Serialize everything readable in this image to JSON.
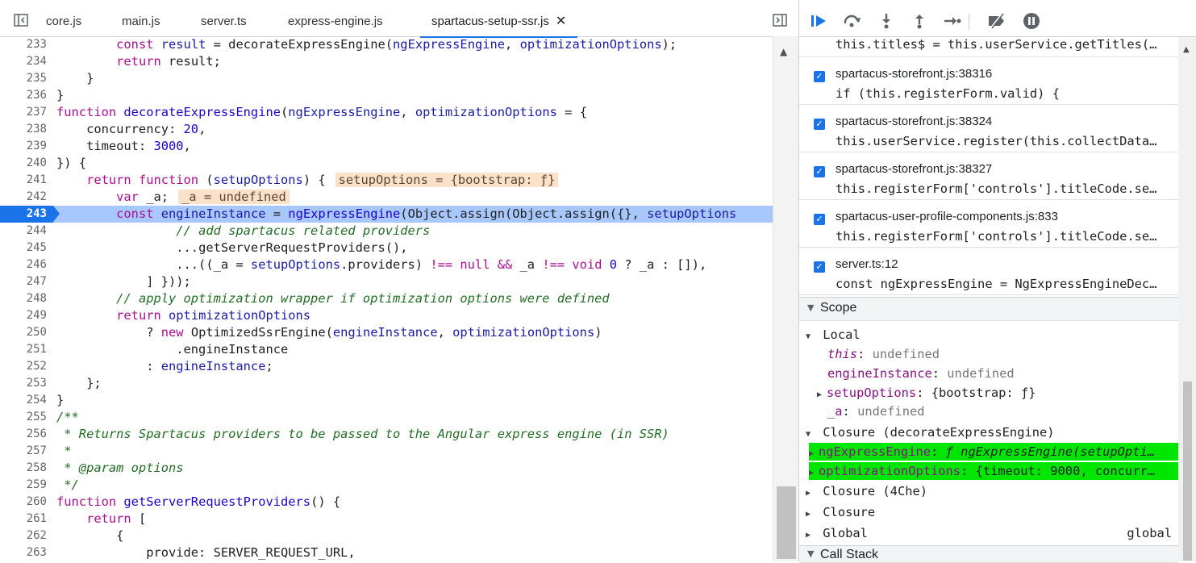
{
  "tabs": [
    {
      "label": "core.js",
      "active": false
    },
    {
      "label": "main.js",
      "active": false
    },
    {
      "label": "server.ts",
      "active": false
    },
    {
      "label": "express-engine.js",
      "active": false
    },
    {
      "label": "spartacus-setup-ssr.js",
      "active": true
    }
  ],
  "editor": {
    "lines": [
      {
        "n": "233",
        "parts": [
          [
            "pl",
            "        "
          ],
          [
            "kw",
            "const "
          ],
          [
            "id",
            "result"
          ],
          [
            "pl",
            " = "
          ],
          [
            "pl",
            "decorateExpressEngine("
          ],
          [
            "id",
            "ngExpressEngine"
          ],
          [
            "pl",
            ", "
          ],
          [
            "id",
            "optimizationOptions"
          ],
          [
            "pl",
            ");"
          ]
        ]
      },
      {
        "n": "234",
        "parts": [
          [
            "pl",
            "        "
          ],
          [
            "kw",
            "return "
          ],
          [
            "pl",
            "result;"
          ]
        ]
      },
      {
        "n": "235",
        "parts": [
          [
            "pl",
            "    }"
          ]
        ]
      },
      {
        "n": "236",
        "parts": [
          [
            "pl",
            "}"
          ]
        ]
      },
      {
        "n": "237",
        "parts": [
          [
            "kw",
            "function "
          ],
          [
            "fn",
            "decorateExpressEngine"
          ],
          [
            "pl",
            "("
          ],
          [
            "id",
            "ngExpressEngine"
          ],
          [
            "pl",
            ", "
          ],
          [
            "id",
            "optimizationOptions"
          ],
          [
            "pl",
            " = {"
          ]
        ]
      },
      {
        "n": "238",
        "parts": [
          [
            "pl",
            "    concurrency: "
          ],
          [
            "num",
            "20"
          ],
          [
            "pl",
            ","
          ]
        ]
      },
      {
        "n": "239",
        "parts": [
          [
            "pl",
            "    timeout: "
          ],
          [
            "num",
            "3000"
          ],
          [
            "pl",
            ","
          ]
        ]
      },
      {
        "n": "240",
        "parts": [
          [
            "pl",
            "}) {"
          ]
        ]
      },
      {
        "n": "241",
        "parts": [
          [
            "pl",
            "    "
          ],
          [
            "kw",
            "return function "
          ],
          [
            "pl",
            "("
          ],
          [
            "id",
            "setupOptions"
          ],
          [
            "pl",
            ") {"
          ]
        ],
        "inline": "setupOptions = {bootstrap: ƒ}"
      },
      {
        "n": "242",
        "parts": [
          [
            "pl",
            "        "
          ],
          [
            "kw",
            "var "
          ],
          [
            "pl",
            "_a;"
          ]
        ],
        "inline": "_a = undefined"
      },
      {
        "n": "243",
        "exec": true,
        "parts": [
          [
            "pl",
            "        "
          ],
          [
            "kw",
            "const "
          ],
          [
            "id",
            "engineInstance"
          ],
          [
            "pl",
            " = "
          ],
          [
            "fn",
            "ngExpressEngine"
          ],
          [
            "pl",
            "(Object.assign(Object.assign({}, "
          ],
          [
            "id",
            "setupOptions"
          ]
        ]
      },
      {
        "n": "244",
        "parts": [
          [
            "pl",
            "                "
          ],
          [
            "cm",
            "// add spartacus related providers"
          ]
        ]
      },
      {
        "n": "245",
        "parts": [
          [
            "pl",
            "                ..."
          ],
          [
            "pl",
            "getServerRequestProviders(),"
          ]
        ]
      },
      {
        "n": "246",
        "parts": [
          [
            "pl",
            "                ...((_a = "
          ],
          [
            "id",
            "setupOptions"
          ],
          [
            "pl",
            ".providers) "
          ],
          [
            "kw",
            "!== null && "
          ],
          [
            "pl",
            "_a "
          ],
          [
            "kw",
            "!== void "
          ],
          [
            "num",
            "0"
          ],
          [
            "pl",
            " ? _a : []),"
          ]
        ]
      },
      {
        "n": "247",
        "parts": [
          [
            "pl",
            "            ] }));"
          ]
        ]
      },
      {
        "n": "248",
        "parts": [
          [
            "pl",
            "        "
          ],
          [
            "cm",
            "// apply optimization wrapper if optimization options were defined"
          ]
        ]
      },
      {
        "n": "249",
        "parts": [
          [
            "pl",
            "        "
          ],
          [
            "kw",
            "return "
          ],
          [
            "id",
            "optimizationOptions"
          ]
        ]
      },
      {
        "n": "250",
        "parts": [
          [
            "pl",
            "            ? "
          ],
          [
            "kw",
            "new "
          ],
          [
            "pl",
            "OptimizedSsrEngine("
          ],
          [
            "id",
            "engineInstance"
          ],
          [
            "pl",
            ", "
          ],
          [
            "id",
            "optimizationOptions"
          ],
          [
            "pl",
            ")"
          ]
        ]
      },
      {
        "n": "251",
        "parts": [
          [
            "pl",
            "                .engineInstance"
          ]
        ]
      },
      {
        "n": "252",
        "parts": [
          [
            "pl",
            "            : "
          ],
          [
            "id",
            "engineInstance"
          ],
          [
            "pl",
            ";"
          ]
        ]
      },
      {
        "n": "253",
        "parts": [
          [
            "pl",
            "    };"
          ]
        ]
      },
      {
        "n": "254",
        "parts": [
          [
            "pl",
            "}"
          ]
        ]
      },
      {
        "n": "255",
        "parts": [
          [
            "cm",
            "/**"
          ]
        ]
      },
      {
        "n": "256",
        "parts": [
          [
            "cm",
            " * Returns Spartacus providers to be passed to the Angular express engine (in SSR)"
          ]
        ]
      },
      {
        "n": "257",
        "parts": [
          [
            "cm",
            " *"
          ]
        ]
      },
      {
        "n": "258",
        "parts": [
          [
            "cm",
            " * @param options"
          ]
        ]
      },
      {
        "n": "259",
        "parts": [
          [
            "cm",
            " */"
          ]
        ]
      },
      {
        "n": "260",
        "parts": [
          [
            "kw",
            "function "
          ],
          [
            "fn",
            "getServerRequestProviders"
          ],
          [
            "pl",
            "() {"
          ]
        ]
      },
      {
        "n": "261",
        "parts": [
          [
            "pl",
            "    "
          ],
          [
            "kw",
            "return "
          ],
          [
            "pl",
            "["
          ]
        ]
      },
      {
        "n": "262",
        "parts": [
          [
            "pl",
            "        {"
          ]
        ]
      },
      {
        "n": "263",
        "parts": [
          [
            "pl",
            "            provide: SERVER_REQUEST_URL,"
          ]
        ]
      }
    ]
  },
  "breakpoints": [
    {
      "file": "",
      "code": "this.titles$ = this.userService.getTitles(…"
    },
    {
      "file": "spartacus-storefront.js:38316",
      "code": "if (this.registerForm.valid) {"
    },
    {
      "file": "spartacus-storefront.js:38324",
      "code": "this.userService.register(this.collectData…"
    },
    {
      "file": "spartacus-storefront.js:38327",
      "code": "this.registerForm['controls'].titleCode.se…"
    },
    {
      "file": "spartacus-user-profile-components.js:833",
      "code": "this.registerForm['controls'].titleCode.se…"
    },
    {
      "file": "server.ts:12",
      "code": "const ngExpressEngine = NgExpressEngineDec…"
    }
  ],
  "scope": {
    "header": "Scope",
    "local_label": "Local",
    "local": [
      {
        "name": "this",
        "sep": ": ",
        "value": "undefined",
        "italic": true
      },
      {
        "name": "engineInstance",
        "sep": ": ",
        "value": "undefined"
      },
      {
        "name": "setupOptions",
        "sep": ": ",
        "value": "{bootstrap: ƒ}",
        "expandable": true
      },
      {
        "name": "_a",
        "sep": ": ",
        "value": "undefined"
      }
    ],
    "closure_label": "Closure (decorateExpressEngine)",
    "closure": [
      {
        "name": "ngExpressEngine",
        "sep": ": ",
        "value": "ƒ ngExpressEngine(setupOpti…"
      },
      {
        "name": "optimizationOptions",
        "sep": ": ",
        "value": "{timeout: 9000, concurr…"
      }
    ],
    "closure2_label": "Closure (4Che)",
    "closure3_label": "Closure",
    "global_label": "Global",
    "global_value": "global"
  },
  "call_stack_label": "Call Stack",
  "colors": {
    "accent": "#1a73e8",
    "highlight": "#00e600",
    "exec_line": "#a8c7fa"
  }
}
